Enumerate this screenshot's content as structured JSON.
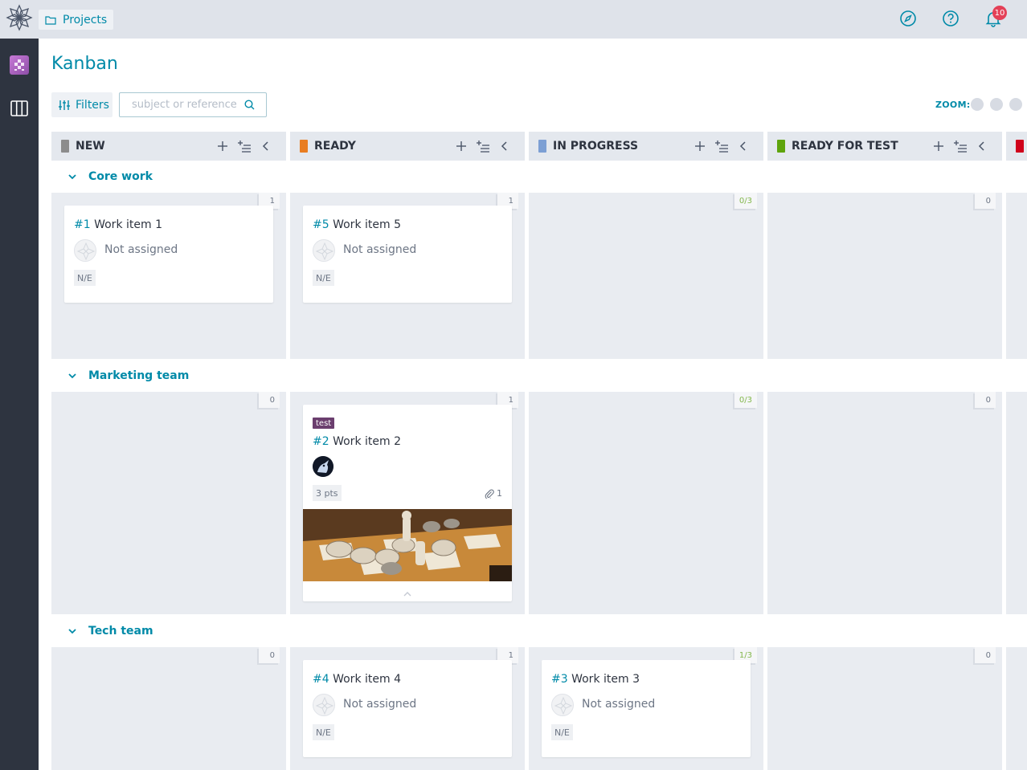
{
  "topbar": {
    "projects_label": "Projects",
    "notification_count": "10"
  },
  "page": {
    "title": "Kanban"
  },
  "toolbar": {
    "filters_label": "Filters",
    "search_placeholder": "subject or reference",
    "zoom_label": "ZOOM:"
  },
  "columns": [
    {
      "name": "NEW",
      "color": "#8c8c8c"
    },
    {
      "name": "READY",
      "color": "#e97d21"
    },
    {
      "name": "IN PROGRESS",
      "color": "#7c9fd4"
    },
    {
      "name": "READY FOR TEST",
      "color": "#5ea40c"
    },
    {
      "name": "",
      "color": "#d0021b"
    }
  ],
  "lanes": [
    {
      "title": "Core work",
      "counts": [
        "1",
        "1",
        "0/3",
        "0"
      ],
      "cards": {
        "new": {
          "ref": "#1",
          "title": "Work item 1",
          "assignee": "Not assigned",
          "estimate": "N/E"
        },
        "ready": {
          "ref": "#5",
          "title": "Work item 5",
          "assignee": "Not assigned",
          "estimate": "N/E"
        }
      }
    },
    {
      "title": "Marketing team",
      "counts": [
        "0",
        "1",
        "0/3",
        "0"
      ],
      "cards": {
        "ready": {
          "tag": "test",
          "ref": "#2",
          "title": "Work item 2",
          "points": "3 pts",
          "attachments": "1"
        }
      }
    },
    {
      "title": "Tech team",
      "counts": [
        "0",
        "1",
        "1/3",
        "0"
      ],
      "cards": {
        "ready": {
          "ref": "#4",
          "title": "Work item 4",
          "assignee": "Not assigned",
          "estimate": "N/E"
        },
        "in_progress": {
          "ref": "#3",
          "title": "Work item 3",
          "assignee": "Not assigned",
          "estimate": "N/E"
        }
      }
    }
  ]
}
